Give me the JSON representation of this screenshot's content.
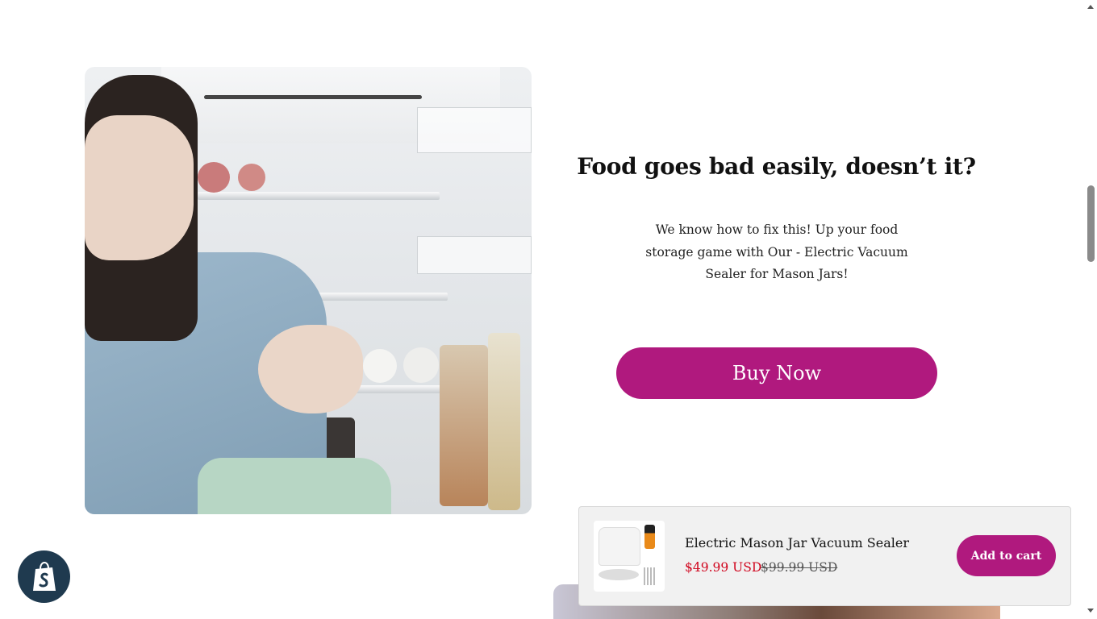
{
  "hero": {
    "headline": "Food goes bad easily, doesn’t it?",
    "description": "We know how to fix this! Up your food storage game with Our - Electric Vacuum Sealer for Mason Jars!",
    "cta_label": "Buy Now"
  },
  "sticky_cart": {
    "product_title": "Electric Mason Jar Vacuum Sealer",
    "sale_price": "$49.99 USD",
    "compare_price": "$99.99 USD",
    "add_to_cart_label": "Add to cart"
  },
  "colors": {
    "accent": "#b0197e",
    "sale_price": "#d0021b",
    "badge": "#1f3a4f"
  },
  "icons": {
    "shopify_badge": "shopify-bag-icon"
  }
}
